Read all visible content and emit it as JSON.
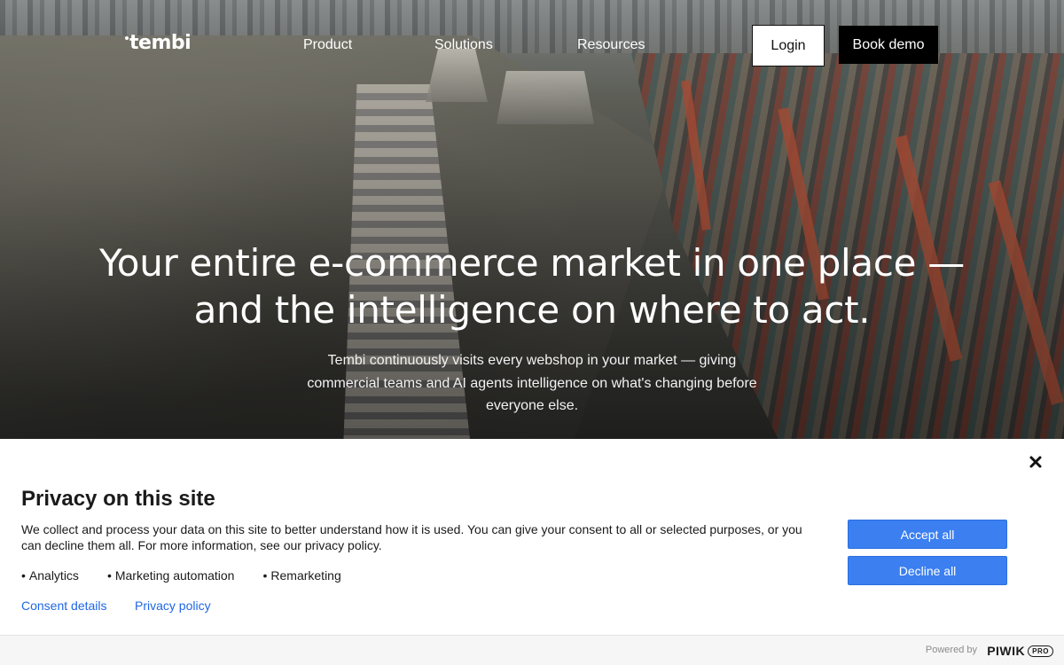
{
  "nav": {
    "logo": "tembi",
    "links": [
      "Product",
      "Solutions",
      "Resources"
    ],
    "login_label": "Login",
    "demo_label": "Book demo"
  },
  "hero": {
    "headline_line1": "Your entire e-commerce market in one place —",
    "headline_line2": "and the intelligence on where to act.",
    "subtext": "Tembi continuously visits every webshop in your market  — giving commercial teams and AI agents intelligence on what's changing before everyone else.",
    "background_image": "container-port-harbor-photo"
  },
  "privacy": {
    "title": "Privacy on this site",
    "description": "We collect and process your data on this site to better understand how it is used. You can give your consent to all or selected purposes, or you can decline them all. For more information, see our privacy policy.",
    "purposes": [
      "Analytics",
      "Marketing automation",
      "Remarketing"
    ],
    "consent_details_label": "Consent details",
    "privacy_policy_label": "Privacy policy",
    "accept_label": "Accept all",
    "decline_label": "Decline all",
    "close_icon": "close-icon"
  },
  "footer": {
    "powered_by": "Powered by",
    "brand": "PIWIK",
    "brand_badge": "PRO"
  },
  "colors": {
    "accent_blue": "#3b7ff0",
    "link_blue": "#1f66e5",
    "demo_button_bg": "#000000"
  }
}
